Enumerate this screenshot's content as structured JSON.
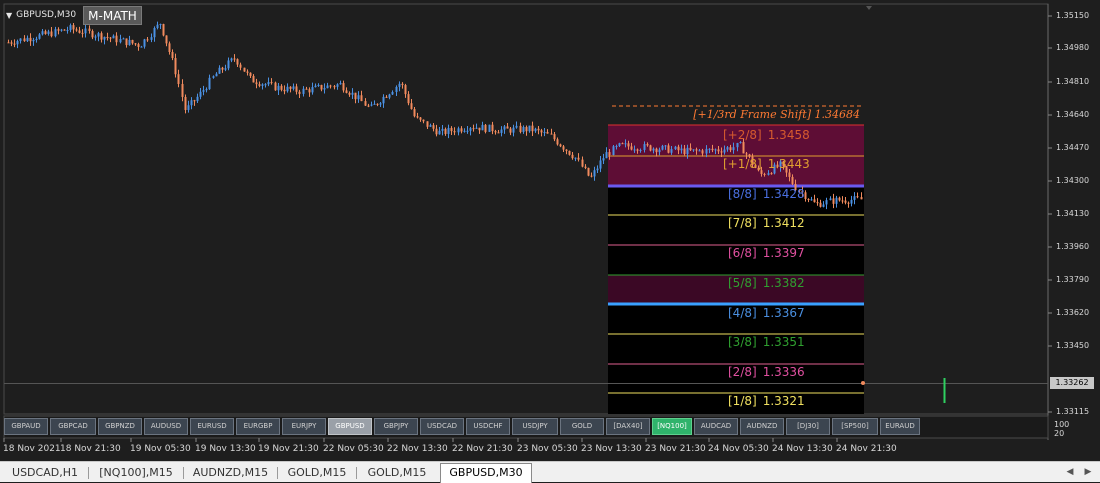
{
  "chart": {
    "symbol_label": "GBPUSD,M30",
    "indicator_button": "M-MATH",
    "current_price": "1.33262",
    "price_axis": [
      "1.35150",
      "1.34980",
      "1.34810",
      "1.34640",
      "1.34470",
      "1.34300",
      "1.34130",
      "1.33960",
      "1.33790",
      "1.33620",
      "1.33450",
      "1.33115"
    ],
    "sub_scale": [
      "100",
      "20"
    ],
    "time_axis": [
      "18 Nov 2021",
      "18 Nov 21:30",
      "19 Nov 05:30",
      "19 Nov 13:30",
      "19 Nov 21:30",
      "22 Nov 05:30",
      "22 Nov 13:30",
      "22 Nov 21:30",
      "23 Nov 05:30",
      "23 Nov 13:30",
      "23 Nov 21:30",
      "24 Nov 05:30",
      "24 Nov 13:30",
      "24 Nov 21:30"
    ],
    "colors": {
      "background": "#1e1e1e",
      "bull": "#4a90e2",
      "bear": "#f08a5d",
      "grid": "#2a2a2a"
    }
  },
  "murrey": {
    "frame_shift": "[+1/3rd Frame Shift]  1.34684",
    "levels": [
      {
        "label": "[+2/8]",
        "price": "1.3458",
        "color": "#d65a2e",
        "line": "#e03030"
      },
      {
        "label": "[+1/8]",
        "price": "1.3443",
        "color": "#e0a030",
        "line": "#e0a030"
      },
      {
        "label": "[8/8]",
        "price": "1.3428",
        "color": "#4a6fe0",
        "line": "#6a5af0"
      },
      {
        "label": "[7/8]",
        "price": "1.3412",
        "color": "#f0e060",
        "line": "#f0e060"
      },
      {
        "label": "[6/8]",
        "price": "1.3397",
        "color": "#e050a0",
        "line": "#e06090"
      },
      {
        "label": "[5/8]",
        "price": "1.3382",
        "color": "#30a030",
        "line": "#30a030"
      },
      {
        "label": "[4/8]",
        "price": "1.3367",
        "color": "#4a8fe0",
        "line": "#3aa0ff"
      },
      {
        "label": "[3/8]",
        "price": "1.3351",
        "color": "#30a030",
        "line": "#f0e060"
      },
      {
        "label": "[2/8]",
        "price": "1.3336",
        "color": "#e050a0",
        "line": "#e06090"
      },
      {
        "label": "[1/8]",
        "price": "1.3321",
        "color": "#f0e060",
        "line": "#f0e060"
      }
    ]
  },
  "symbol_buttons": [
    {
      "label": "GBPAUD",
      "state": "normal"
    },
    {
      "label": "GBPCAD",
      "state": "normal"
    },
    {
      "label": "GBPNZD",
      "state": "normal"
    },
    {
      "label": "AUDUSD",
      "state": "normal"
    },
    {
      "label": "EURUSD",
      "state": "normal"
    },
    {
      "label": "EURGBP",
      "state": "normal"
    },
    {
      "label": "EURJPY",
      "state": "normal"
    },
    {
      "label": "GBPUSD",
      "state": "active"
    },
    {
      "label": "GBPJPY",
      "state": "normal"
    },
    {
      "label": "USDCAD",
      "state": "normal"
    },
    {
      "label": "USDCHF",
      "state": "normal"
    },
    {
      "label": "USDJPY",
      "state": "normal"
    },
    {
      "label": "GOLD",
      "state": "normal"
    },
    {
      "label": "[DAX40]",
      "state": "normal"
    },
    {
      "label": "[NQ100]",
      "state": "nq"
    },
    {
      "label": "AUDCAD",
      "state": "normal"
    },
    {
      "label": "AUDNZD",
      "state": "normal"
    },
    {
      "label": "[DJ30]",
      "state": "normal"
    },
    {
      "label": "[SP500]",
      "state": "normal"
    },
    {
      "label": "EURAUD",
      "state": "normal"
    }
  ],
  "tabs": [
    {
      "label": "USDCAD,H1",
      "active": false
    },
    {
      "label": "[NQ100],M15",
      "active": false
    },
    {
      "label": "AUDNZD,M15",
      "active": false
    },
    {
      "label": "GOLD,M15",
      "active": false
    },
    {
      "label": "GOLD,M15",
      "active": false
    },
    {
      "label": "GBPUSD,M30",
      "active": true
    }
  ]
}
